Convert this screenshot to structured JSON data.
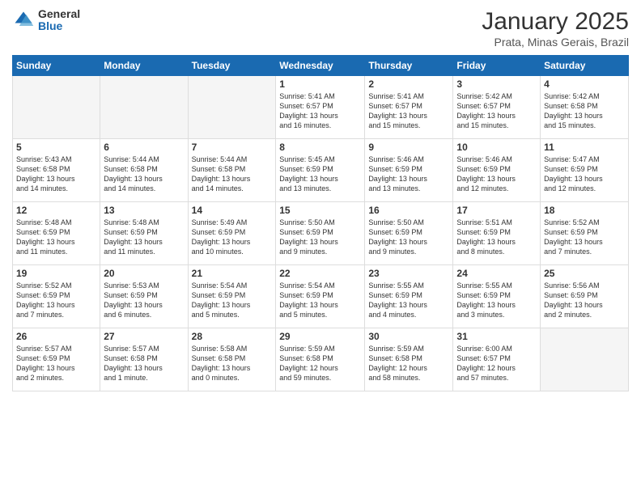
{
  "logo": {
    "general": "General",
    "blue": "Blue"
  },
  "title": "January 2025",
  "subtitle": "Prata, Minas Gerais, Brazil",
  "headers": [
    "Sunday",
    "Monday",
    "Tuesday",
    "Wednesday",
    "Thursday",
    "Friday",
    "Saturday"
  ],
  "weeks": [
    [
      {
        "num": "",
        "info": ""
      },
      {
        "num": "",
        "info": ""
      },
      {
        "num": "",
        "info": ""
      },
      {
        "num": "1",
        "info": "Sunrise: 5:41 AM\nSunset: 6:57 PM\nDaylight: 13 hours\nand 16 minutes."
      },
      {
        "num": "2",
        "info": "Sunrise: 5:41 AM\nSunset: 6:57 PM\nDaylight: 13 hours\nand 15 minutes."
      },
      {
        "num": "3",
        "info": "Sunrise: 5:42 AM\nSunset: 6:57 PM\nDaylight: 13 hours\nand 15 minutes."
      },
      {
        "num": "4",
        "info": "Sunrise: 5:42 AM\nSunset: 6:58 PM\nDaylight: 13 hours\nand 15 minutes."
      }
    ],
    [
      {
        "num": "5",
        "info": "Sunrise: 5:43 AM\nSunset: 6:58 PM\nDaylight: 13 hours\nand 14 minutes."
      },
      {
        "num": "6",
        "info": "Sunrise: 5:44 AM\nSunset: 6:58 PM\nDaylight: 13 hours\nand 14 minutes."
      },
      {
        "num": "7",
        "info": "Sunrise: 5:44 AM\nSunset: 6:58 PM\nDaylight: 13 hours\nand 14 minutes."
      },
      {
        "num": "8",
        "info": "Sunrise: 5:45 AM\nSunset: 6:59 PM\nDaylight: 13 hours\nand 13 minutes."
      },
      {
        "num": "9",
        "info": "Sunrise: 5:46 AM\nSunset: 6:59 PM\nDaylight: 13 hours\nand 13 minutes."
      },
      {
        "num": "10",
        "info": "Sunrise: 5:46 AM\nSunset: 6:59 PM\nDaylight: 13 hours\nand 12 minutes."
      },
      {
        "num": "11",
        "info": "Sunrise: 5:47 AM\nSunset: 6:59 PM\nDaylight: 13 hours\nand 12 minutes."
      }
    ],
    [
      {
        "num": "12",
        "info": "Sunrise: 5:48 AM\nSunset: 6:59 PM\nDaylight: 13 hours\nand 11 minutes."
      },
      {
        "num": "13",
        "info": "Sunrise: 5:48 AM\nSunset: 6:59 PM\nDaylight: 13 hours\nand 11 minutes."
      },
      {
        "num": "14",
        "info": "Sunrise: 5:49 AM\nSunset: 6:59 PM\nDaylight: 13 hours\nand 10 minutes."
      },
      {
        "num": "15",
        "info": "Sunrise: 5:50 AM\nSunset: 6:59 PM\nDaylight: 13 hours\nand 9 minutes."
      },
      {
        "num": "16",
        "info": "Sunrise: 5:50 AM\nSunset: 6:59 PM\nDaylight: 13 hours\nand 9 minutes."
      },
      {
        "num": "17",
        "info": "Sunrise: 5:51 AM\nSunset: 6:59 PM\nDaylight: 13 hours\nand 8 minutes."
      },
      {
        "num": "18",
        "info": "Sunrise: 5:52 AM\nSunset: 6:59 PM\nDaylight: 13 hours\nand 7 minutes."
      }
    ],
    [
      {
        "num": "19",
        "info": "Sunrise: 5:52 AM\nSunset: 6:59 PM\nDaylight: 13 hours\nand 7 minutes."
      },
      {
        "num": "20",
        "info": "Sunrise: 5:53 AM\nSunset: 6:59 PM\nDaylight: 13 hours\nand 6 minutes."
      },
      {
        "num": "21",
        "info": "Sunrise: 5:54 AM\nSunset: 6:59 PM\nDaylight: 13 hours\nand 5 minutes."
      },
      {
        "num": "22",
        "info": "Sunrise: 5:54 AM\nSunset: 6:59 PM\nDaylight: 13 hours\nand 5 minutes."
      },
      {
        "num": "23",
        "info": "Sunrise: 5:55 AM\nSunset: 6:59 PM\nDaylight: 13 hours\nand 4 minutes."
      },
      {
        "num": "24",
        "info": "Sunrise: 5:55 AM\nSunset: 6:59 PM\nDaylight: 13 hours\nand 3 minutes."
      },
      {
        "num": "25",
        "info": "Sunrise: 5:56 AM\nSunset: 6:59 PM\nDaylight: 13 hours\nand 2 minutes."
      }
    ],
    [
      {
        "num": "26",
        "info": "Sunrise: 5:57 AM\nSunset: 6:59 PM\nDaylight: 13 hours\nand 2 minutes."
      },
      {
        "num": "27",
        "info": "Sunrise: 5:57 AM\nSunset: 6:58 PM\nDaylight: 13 hours\nand 1 minute."
      },
      {
        "num": "28",
        "info": "Sunrise: 5:58 AM\nSunset: 6:58 PM\nDaylight: 13 hours\nand 0 minutes."
      },
      {
        "num": "29",
        "info": "Sunrise: 5:59 AM\nSunset: 6:58 PM\nDaylight: 12 hours\nand 59 minutes."
      },
      {
        "num": "30",
        "info": "Sunrise: 5:59 AM\nSunset: 6:58 PM\nDaylight: 12 hours\nand 58 minutes."
      },
      {
        "num": "31",
        "info": "Sunrise: 6:00 AM\nSunset: 6:57 PM\nDaylight: 12 hours\nand 57 minutes."
      },
      {
        "num": "",
        "info": ""
      }
    ]
  ]
}
